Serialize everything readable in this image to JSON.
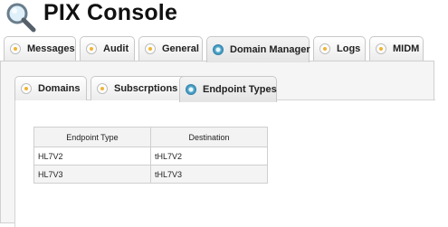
{
  "app": {
    "title": "PIX Console",
    "logo_icon": "magnifier-logo-icon"
  },
  "tabs": [
    {
      "label": "Messages",
      "icon": "plus-circle-icon",
      "active": false
    },
    {
      "label": "Audit",
      "icon": "plus-circle-icon",
      "active": false
    },
    {
      "label": "General",
      "icon": "plus-circle-icon",
      "active": false
    },
    {
      "label": "Domain Manager",
      "icon": "blue-circle-icon",
      "active": true
    },
    {
      "label": "Logs",
      "icon": "plus-circle-icon",
      "active": false
    },
    {
      "label": "MIDM",
      "icon": "plus-circle-icon",
      "active": false
    }
  ],
  "subtabs": [
    {
      "label": "Domains",
      "icon": "plus-circle-icon",
      "active": false
    },
    {
      "label": "Subscrptions",
      "icon": "plus-circle-icon",
      "active": false
    },
    {
      "label": "Endpoint Types",
      "icon": "blue-circle-icon",
      "active": true
    }
  ],
  "table": {
    "columns": [
      "Endpoint Type",
      "Destination"
    ],
    "rows": [
      [
        "HL7V2",
        "tHL7V2"
      ],
      [
        "HL7V3",
        "tHL7V3"
      ]
    ]
  },
  "colors": {
    "accent": "#2d7fa8",
    "plus_dot": "#f2b233"
  }
}
